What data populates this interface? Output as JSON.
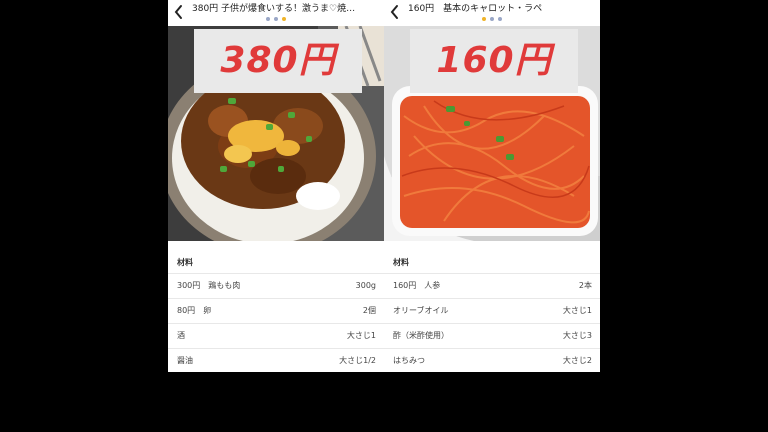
{
  "left": {
    "title": "380円 子供が爆食いする！激うま♡焼…",
    "price": "380円",
    "ingredients_header": "材料",
    "ingredients": [
      {
        "name": "300円　鶏もも肉",
        "qty": "300g"
      },
      {
        "name": "80円　卵",
        "qty": "2個"
      },
      {
        "name": "酒",
        "qty": "大さじ1"
      },
      {
        "name": "醤油",
        "qty": "大さじ1/2"
      }
    ],
    "dots_active_index": 2
  },
  "right": {
    "title": "160円　基本のキャロット・ラペ",
    "price": "160円",
    "ingredients_header": "材料",
    "ingredients": [
      {
        "name": "160円　人参",
        "qty": "2本"
      },
      {
        "name": "オリーブオイル",
        "qty": "大さじ1"
      },
      {
        "name": "酢（米酢使用）",
        "qty": "大さじ3"
      },
      {
        "name": "はちみつ",
        "qty": "大さじ2"
      }
    ],
    "dots_active_index": 0
  },
  "icons": {
    "back": "chevron-left-icon"
  },
  "colors": {
    "price_red": "#e03a3a",
    "dot_active": "#f0b429",
    "dot_inactive": "#9aa7c7",
    "background": "#000000"
  }
}
